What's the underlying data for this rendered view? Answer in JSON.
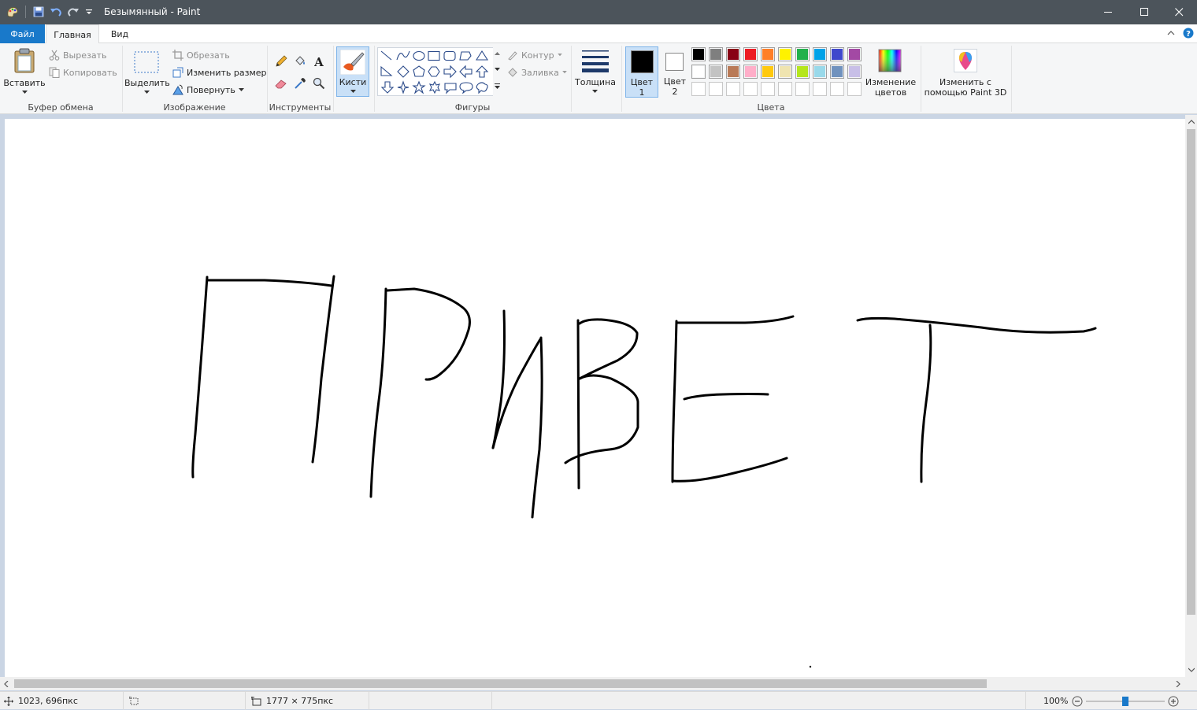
{
  "window": {
    "title": "Безымянный - Paint"
  },
  "menu": {
    "file": "Файл",
    "home": "Главная",
    "view": "Вид"
  },
  "clipboard": {
    "paste": "Вставить",
    "cut": "Вырезать",
    "copy": "Копировать",
    "group": "Буфер обмена"
  },
  "image": {
    "select": "Выделить",
    "crop": "Обрезать",
    "resize": "Изменить размер",
    "rotate": "Повернуть",
    "group": "Изображение"
  },
  "tools": {
    "group": "Инструменты"
  },
  "brushes": {
    "label": "Кисти"
  },
  "shapes": {
    "outline": "Контур",
    "fill": "Заливка",
    "group": "Фигуры"
  },
  "size": {
    "label": "Толщина"
  },
  "colors": {
    "color1_line1": "Цвет",
    "color1_line2": "1",
    "color2_line1": "Цвет",
    "color2_line2": "2",
    "edit_line1": "Изменение",
    "edit_line2": "цветов",
    "group": "Цвета",
    "color1": "#000000",
    "color2": "#ffffff",
    "palette_row1": [
      "#000000",
      "#7f7f7f",
      "#880015",
      "#ed1c24",
      "#ff7f27",
      "#fff200",
      "#22b14c",
      "#00a2e8",
      "#3f48cc",
      "#a349a4"
    ],
    "palette_row2": [
      "#ffffff",
      "#c3c3c3",
      "#b97a57",
      "#ffaec9",
      "#ffc90e",
      "#efe4b0",
      "#b5e61d",
      "#99d9ea",
      "#7092be",
      "#c8bfe7"
    ],
    "palette_row3": [
      "#ffffff",
      "#ffffff",
      "#ffffff",
      "#ffffff",
      "#ffffff",
      "#ffffff",
      "#ffffff",
      "#ffffff",
      "#ffffff",
      "#ffffff"
    ]
  },
  "paint3d": {
    "line1": "Изменить с",
    "line2": "помощью Paint 3D"
  },
  "status": {
    "cursor": "1023, 696пкс",
    "image_size": "1777 × 775пкс",
    "zoom": "100%",
    "zoom_level": 1.0
  }
}
